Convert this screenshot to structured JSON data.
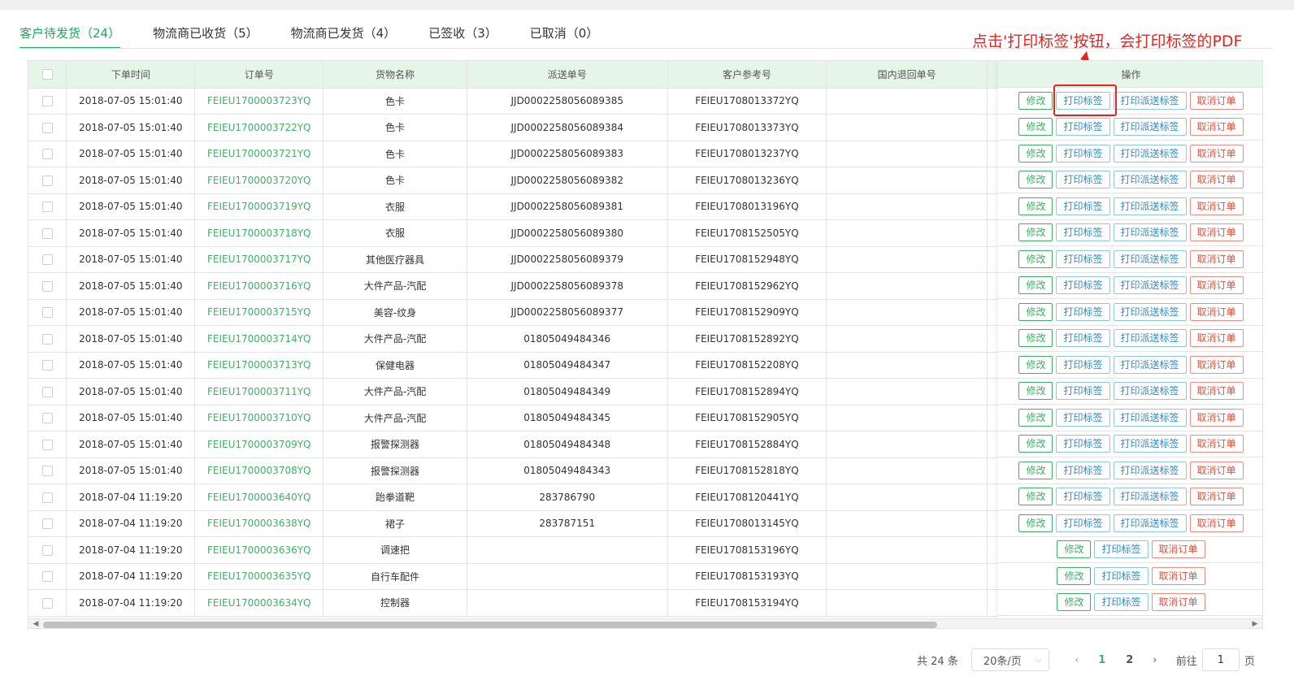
{
  "tabs": [
    {
      "label": "客户待发货（24）",
      "active": true
    },
    {
      "label": "物流商已收货（5）",
      "active": false
    },
    {
      "label": "物流商已发货（4）",
      "active": false
    },
    {
      "label": "已签收（3）",
      "active": false
    },
    {
      "label": "已取消（0）",
      "active": false
    }
  ],
  "annotation": {
    "text": "点击'打印标签'按钮，会打印标签的PDF",
    "color": "#e8231f"
  },
  "table": {
    "headers": {
      "time": "下单时间",
      "order": "订单号",
      "goods": "货物名称",
      "delivery": "派送单号",
      "ref": "客户参考号",
      "return": "国内退回单号",
      "ops": "操作"
    },
    "buttons": {
      "edit": "修改",
      "print": "打印标签",
      "print_delivery": "打印派送标签",
      "cancel": "取消订单"
    },
    "rows": [
      {
        "time": "2018-07-05 15:01:40",
        "order": "FEIEU1700003723YQ",
        "goods": "色卡",
        "delivery": "JJD0002258056089385",
        "ref": "FEIEU1708013372YQ",
        "return": "",
        "has_delivery_label": true
      },
      {
        "time": "2018-07-05 15:01:40",
        "order": "FEIEU1700003722YQ",
        "goods": "色卡",
        "delivery": "JJD0002258056089384",
        "ref": "FEIEU1708013373YQ",
        "return": "",
        "has_delivery_label": true
      },
      {
        "time": "2018-07-05 15:01:40",
        "order": "FEIEU1700003721YQ",
        "goods": "色卡",
        "delivery": "JJD0002258056089383",
        "ref": "FEIEU1708013237YQ",
        "return": "",
        "has_delivery_label": true
      },
      {
        "time": "2018-07-05 15:01:40",
        "order": "FEIEU1700003720YQ",
        "goods": "色卡",
        "delivery": "JJD0002258056089382",
        "ref": "FEIEU1708013236YQ",
        "return": "",
        "has_delivery_label": true
      },
      {
        "time": "2018-07-05 15:01:40",
        "order": "FEIEU1700003719YQ",
        "goods": "衣服",
        "delivery": "JJD0002258056089381",
        "ref": "FEIEU1708013196YQ",
        "return": "",
        "has_delivery_label": true
      },
      {
        "time": "2018-07-05 15:01:40",
        "order": "FEIEU1700003718YQ",
        "goods": "衣服",
        "delivery": "JJD0002258056089380",
        "ref": "FEIEU1708152505YQ",
        "return": "",
        "has_delivery_label": true
      },
      {
        "time": "2018-07-05 15:01:40",
        "order": "FEIEU1700003717YQ",
        "goods": "其他医疗器具",
        "delivery": "JJD0002258056089379",
        "ref": "FEIEU1708152948YQ",
        "return": "",
        "has_delivery_label": true
      },
      {
        "time": "2018-07-05 15:01:40",
        "order": "FEIEU1700003716YQ",
        "goods": "大件产品-汽配",
        "delivery": "JJD0002258056089378",
        "ref": "FEIEU1708152962YQ",
        "return": "",
        "has_delivery_label": true
      },
      {
        "time": "2018-07-05 15:01:40",
        "order": "FEIEU1700003715YQ",
        "goods": "美容-纹身",
        "delivery": "JJD0002258056089377",
        "ref": "FEIEU1708152909YQ",
        "return": "",
        "has_delivery_label": true
      },
      {
        "time": "2018-07-05 15:01:40",
        "order": "FEIEU1700003714YQ",
        "goods": "大件产品-汽配",
        "delivery": "01805049484346",
        "ref": "FEIEU1708152892YQ",
        "return": "",
        "has_delivery_label": true
      },
      {
        "time": "2018-07-05 15:01:40",
        "order": "FEIEU1700003713YQ",
        "goods": "保健电器",
        "delivery": "01805049484347",
        "ref": "FEIEU1708152208YQ",
        "return": "",
        "has_delivery_label": true
      },
      {
        "time": "2018-07-05 15:01:40",
        "order": "FEIEU1700003711YQ",
        "goods": "大件产品-汽配",
        "delivery": "01805049484349",
        "ref": "FEIEU1708152894YQ",
        "return": "",
        "has_delivery_label": true
      },
      {
        "time": "2018-07-05 15:01:40",
        "order": "FEIEU1700003710YQ",
        "goods": "大件产品-汽配",
        "delivery": "01805049484345",
        "ref": "FEIEU1708152905YQ",
        "return": "",
        "has_delivery_label": true
      },
      {
        "time": "2018-07-05 15:01:40",
        "order": "FEIEU1700003709YQ",
        "goods": "报警探测器",
        "delivery": "01805049484348",
        "ref": "FEIEU1708152884YQ",
        "return": "",
        "has_delivery_label": true
      },
      {
        "time": "2018-07-05 15:01:40",
        "order": "FEIEU1700003708YQ",
        "goods": "报警探测器",
        "delivery": "01805049484343",
        "ref": "FEIEU1708152818YQ",
        "return": "",
        "has_delivery_label": true
      },
      {
        "time": "2018-07-04 11:19:20",
        "order": "FEIEU1700003640YQ",
        "goods": "跆拳道靶",
        "delivery": "283786790",
        "ref": "FEIEU1708120441YQ",
        "return": "",
        "has_delivery_label": true
      },
      {
        "time": "2018-07-04 11:19:20",
        "order": "FEIEU1700003638YQ",
        "goods": "裙子",
        "delivery": "283787151",
        "ref": "FEIEU1708013145YQ",
        "return": "",
        "has_delivery_label": true
      },
      {
        "time": "2018-07-04 11:19:20",
        "order": "FEIEU1700003636YQ",
        "goods": "调速把",
        "delivery": "",
        "ref": "FEIEU1708153196YQ",
        "return": "",
        "has_delivery_label": false
      },
      {
        "time": "2018-07-04 11:19:20",
        "order": "FEIEU1700003635YQ",
        "goods": "自行车配件",
        "delivery": "",
        "ref": "FEIEU1708153193YQ",
        "return": "",
        "has_delivery_label": false
      },
      {
        "time": "2018-07-04 11:19:20",
        "order": "FEIEU1700003634YQ",
        "goods": "控制器",
        "delivery": "",
        "ref": "FEIEU1708153194YQ",
        "return": "",
        "has_delivery_label": false
      }
    ]
  },
  "pagination": {
    "total": "共 24 条",
    "page_size": "20条/页",
    "pages": [
      "1",
      "2"
    ],
    "current": "1",
    "goto_label": "前往",
    "goto_value": "1",
    "page_suffix": "页"
  },
  "colors": {
    "accent": "#3fb265",
    "print": "#2d8ad0",
    "cancel": "#e9513e",
    "annotation": "#e8231f"
  }
}
